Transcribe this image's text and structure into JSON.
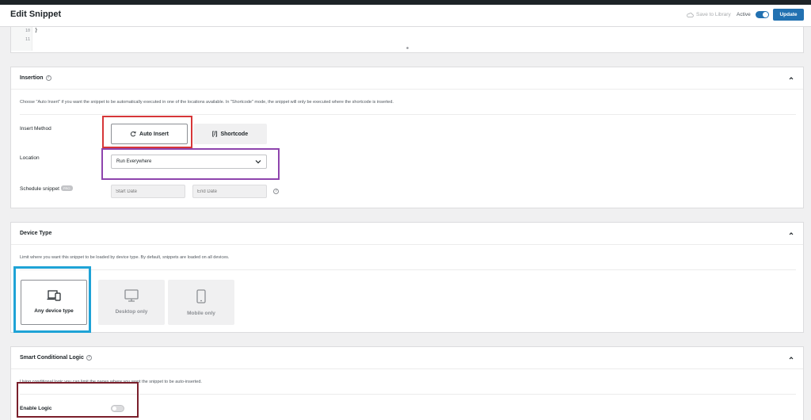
{
  "header": {
    "title": "Edit Snippet",
    "save_to_library": "Save to Library",
    "active_label": "Active",
    "active": true,
    "update_label": "Update"
  },
  "code": {
    "lines": [
      {
        "number": "10",
        "text": "}"
      },
      {
        "number": "11",
        "text": ""
      }
    ]
  },
  "insertion": {
    "title": "Insertion",
    "description": "Choose \"Auto Insert\" if you want the snippet to be automatically executed in one of the locations available. In \"Shortcode\" mode, the snippet will only be executed where the shortcode is inserted.",
    "insert_method_label": "Insert Method",
    "auto_insert_label": "Auto Insert",
    "shortcode_label": "Shortcode",
    "shortcode_prefix": "[/]",
    "location_label": "Location",
    "location_value": "Run Everywhere",
    "schedule_label": "Schedule snippet",
    "schedule_badge": "PRO",
    "start_date_placeholder": "Start Date",
    "end_date_placeholder": "End Date"
  },
  "device_type": {
    "title": "Device Type",
    "description": "Limit where you want this snippet to be loaded by device type. By default, snippets are loaded on all devices.",
    "options": [
      {
        "label": "Any device type",
        "icon": "devices-icon",
        "selected": true
      },
      {
        "label": "Desktop only",
        "icon": "desktop-icon",
        "selected": false
      },
      {
        "label": "Mobile only",
        "icon": "mobile-icon",
        "selected": false
      }
    ]
  },
  "conditional": {
    "title": "Smart Conditional Logic",
    "description": "Using conditional logic you can limit the pages where you want the snippet to be auto-inserted.",
    "enable_label": "Enable Logic",
    "enabled": false
  },
  "colors": {
    "primary": "#2271b1",
    "highlight_red": "#d63638",
    "highlight_purple": "#8e44ad",
    "highlight_blue": "#1fa3d6",
    "highlight_maroon": "#7a1f2b"
  }
}
